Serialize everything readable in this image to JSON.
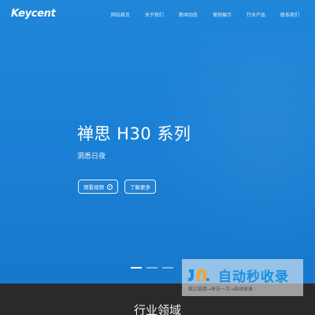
{
  "brand": {
    "logo": "Keycent"
  },
  "nav": {
    "items": [
      "网站首页",
      "关于我们",
      "新闻动态",
      "案例展示",
      "行业产品",
      "联系我们"
    ]
  },
  "hero": {
    "title": "禅思 H30 系列",
    "subtitle": "洞悉日夜",
    "buttons": {
      "watch_video": "观看视频",
      "learn_more": "了解更多"
    },
    "carousel": {
      "count": 3,
      "active_index": 0
    }
  },
  "section": {
    "title": "行业领域"
  },
  "watermark": {
    "title": "自动秒收录",
    "subtitle": "做上链接→来访一次→自动收录"
  },
  "colors": {
    "hero_blue": "#1a7fd4",
    "dark_band": "#2a2a2a",
    "watermark_blue": "#1a8fe0"
  }
}
